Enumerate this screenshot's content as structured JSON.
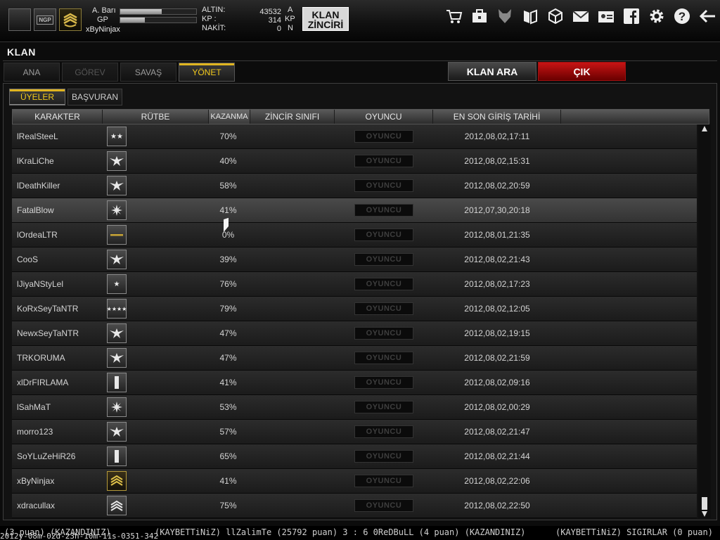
{
  "profile": {
    "stat1_label": "A. Barı",
    "stat1_fill": 0.55,
    "stat2_label": "GP",
    "stat2_fill": 0.32,
    "username": "xByNinjax",
    "slot2_text": "NGP"
  },
  "currency": {
    "gold_label": "ALTIN:",
    "gold_value": "43532",
    "gold_unit": "A",
    "kp_label": "KP :",
    "kp_value": "314",
    "kp_unit": "KP",
    "cash_label": "NAKİT:",
    "cash_value": "0",
    "cash_unit": "N"
  },
  "brand": {
    "line1": "KLAN",
    "line2": "ZİNCİRİ"
  },
  "toolbar_icons": [
    "cart-icon",
    "briefcase-icon",
    "wolf-icon",
    "book-icon",
    "box-icon",
    "mail-icon",
    "id-card-icon",
    "facebook-icon",
    "gear-icon",
    "help-icon",
    "back-arrow-icon"
  ],
  "page": {
    "title": "KLAN",
    "nav_tabs": [
      "ANA",
      "GÖREV",
      "SAVAŞ",
      "YÖNET"
    ],
    "search_button": "KLAN ARA",
    "exit_button": "ÇIK"
  },
  "sub_tabs": [
    "ÜYELER",
    "BAŞVURAN"
  ],
  "table": {
    "headers": [
      "KARAKTER",
      "RÜTBE",
      "KAZANMA",
      "ZİNCİR SINIFI",
      "OYUNCU",
      "EN SON GİRİŞ TARİHİ"
    ],
    "player_button": "OYUNCU",
    "rows": [
      {
        "name": "lRealSteeL",
        "rank": "★★",
        "win": "70%",
        "date": "2012,08,02,17:11"
      },
      {
        "name": "lKraLiChe",
        "rank": "eagle",
        "win": "40%",
        "date": "2012,08,02,15:31"
      },
      {
        "name": "lDeathKiller",
        "rank": "eagle",
        "win": "58%",
        "date": "2012,08,02,20:59"
      },
      {
        "name": "FatalBlow",
        "rank": "leaf",
        "win": "41%",
        "date": "2012,07,30,20:18"
      },
      {
        "name": "lOrdeaLTR",
        "rank": "bar",
        "win": "0%",
        "date": "2012,08,01,21:35"
      },
      {
        "name": "CooS",
        "rank": "eagle",
        "win": "39%",
        "date": "2012,08,02,21:43"
      },
      {
        "name": "lJiyaNStyLel",
        "rank": "★",
        "win": "76%",
        "date": "2012,08,02,17:23"
      },
      {
        "name": "KoRxSeyTaNTR",
        "rank": "★★★★",
        "win": "79%",
        "date": "2012,08,02,12:05"
      },
      {
        "name": "NewxSeyTaNTR",
        "rank": "eagle",
        "win": "47%",
        "date": "2012,08,02,19:15"
      },
      {
        "name": "TRKORUMA",
        "rank": "eagle",
        "win": "47%",
        "date": "2012,08,02,21:59"
      },
      {
        "name": "xlDrFIRLAMA",
        "rank": "vbar",
        "win": "41%",
        "date": "2012,08,02,09:16"
      },
      {
        "name": "lSahMaT",
        "rank": "leaf",
        "win": "53%",
        "date": "2012,08,02,00:29"
      },
      {
        "name": "morro123",
        "rank": "eagle",
        "win": "57%",
        "date": "2012,08,02,21:47"
      },
      {
        "name": "SoYLuZeHiR26",
        "rank": "vbar",
        "win": "65%",
        "date": "2012,08,02,21:44"
      },
      {
        "name": "xByNinjax",
        "rank": "chevron-gold",
        "win": "41%",
        "date": "2012,08,02,22:06"
      },
      {
        "name": "xdracullax",
        "rank": "chevron",
        "win": "75%",
        "date": "2012,08,02,22:50"
      }
    ],
    "selected_row": 3
  },
  "ticker": {
    "segment1": "(3 puan) (KAZANDINIZ)",
    "segment2": "(KAYBETTiNiZ) llZalimTe (25792 puan) 3 : 6 0ReDBuLL (4 puan) (KAZANDINIZ)",
    "segment3": "(KAYBETTiNiZ) SIGIRLAR (0 puan)",
    "stamp": "2012y-08m-02d-23h-10m-11s-0351-342"
  },
  "colors": {
    "accent": "#e0b520",
    "danger": "#c81414",
    "panel": "#121212"
  }
}
